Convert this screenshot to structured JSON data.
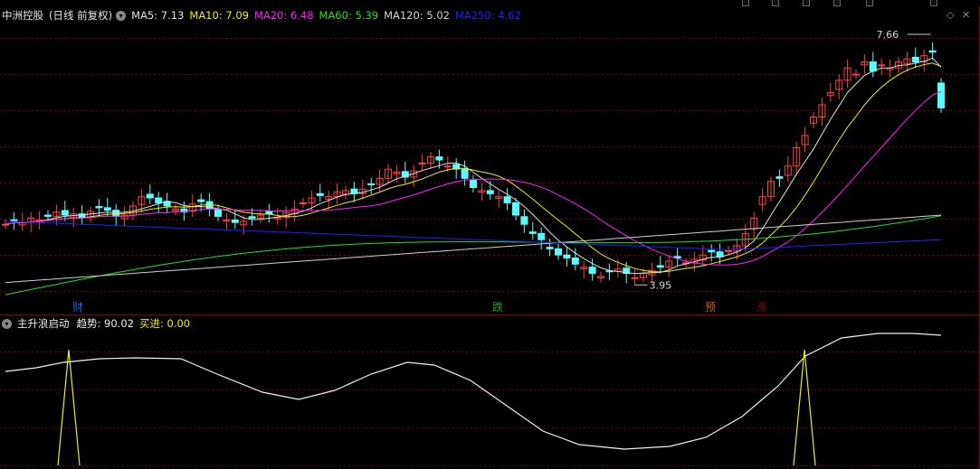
{
  "header": {
    "stock_name": "中洲控股",
    "period_info": "(日线 前复权)"
  },
  "main_panel": {
    "ma_legend": [
      {
        "label": "MA5: 7.13",
        "color": "#e0e0e0"
      },
      {
        "label": "MA10: 7.09",
        "color": "#f0f000"
      },
      {
        "label": "MA20: 6.48",
        "color": "#ff20ff"
      },
      {
        "label": "MA60: 5.39",
        "color": "#20e020"
      },
      {
        "label": "MA120: 5.02",
        "color": "#d0d0d0"
      },
      {
        "label": "MA250: 4.62",
        "color": "#2020ff"
      }
    ],
    "high_label": "7.66",
    "low_label": "3.95",
    "signal_labels": [
      {
        "text": "财",
        "color": "#2a5fcf"
      },
      {
        "text": "跌",
        "color": "#1aa61a"
      },
      {
        "text": "预",
        "color": "#d06000"
      },
      {
        "text": "涨",
        "color": "#8b0000"
      }
    ],
    "up_color": "#ff4040",
    "down_color": "#54ffff"
  },
  "sub_panel": {
    "indicator_name": "主升浪启动",
    "trend_label": "趋势: 90.02",
    "buy_label": "买进: 0.00",
    "trend_color": "#f0f0f0",
    "buy_color": "#f0f000"
  },
  "chart_data": {
    "type": "candlestick",
    "title": "中洲控股 (日线 前复权)",
    "price_high": 7.66,
    "price_low": 3.95,
    "indicators_last": {
      "MA5": 7.13,
      "MA10": 7.09,
      "MA20": 6.48,
      "MA60": 5.39,
      "MA120": 5.02,
      "MA250": 4.62
    },
    "sub_indicator": {
      "name": "主升浪启动",
      "趋势": 90.02,
      "买进": 0.0
    }
  }
}
